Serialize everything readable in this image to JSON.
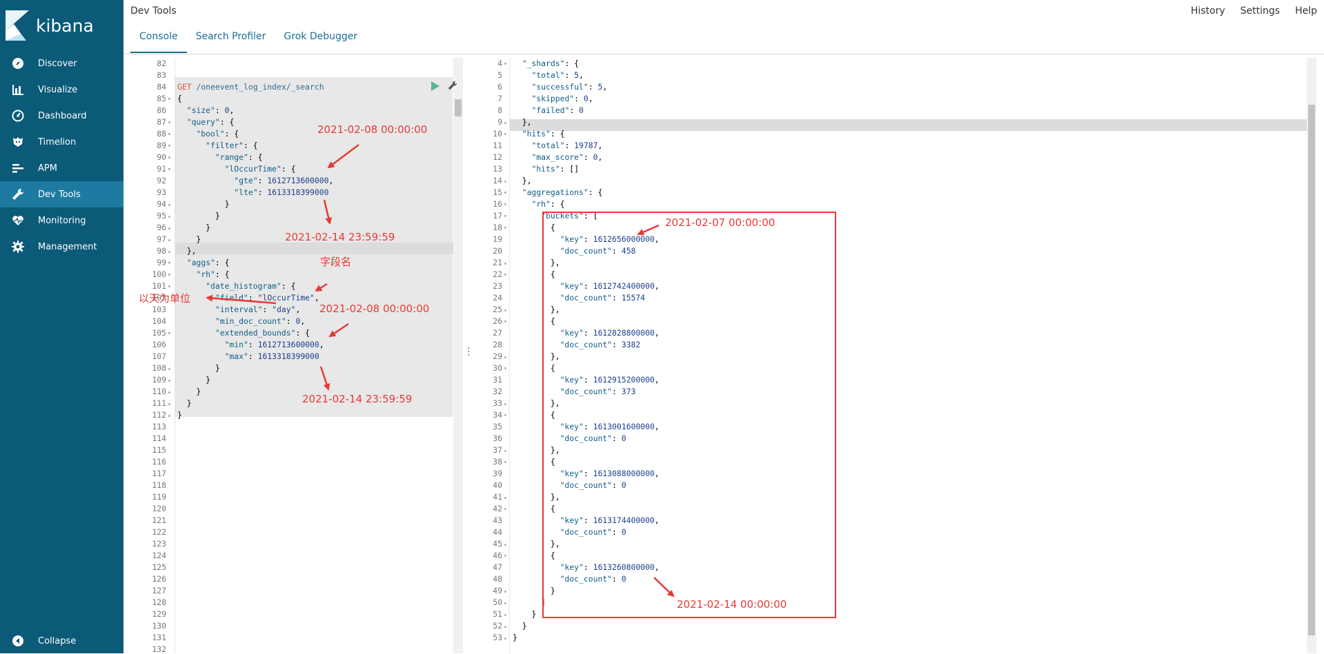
{
  "app": {
    "brand": "kibana",
    "title": "Dev Tools"
  },
  "top_links": [
    "History",
    "Settings",
    "Help"
  ],
  "tabs": [
    "Console",
    "Search Profiler",
    "Grok Debugger"
  ],
  "sidebar": {
    "items": [
      {
        "label": "Discover",
        "icon": "compass-icon"
      },
      {
        "label": "Visualize",
        "icon": "bar-chart-icon"
      },
      {
        "label": "Dashboard",
        "icon": "dashboard-icon"
      },
      {
        "label": "Timelion",
        "icon": "timelion-icon"
      },
      {
        "label": "APM",
        "icon": "apm-icon"
      },
      {
        "label": "Dev Tools",
        "icon": "wrench-icon",
        "active": true
      },
      {
        "label": "Monitoring",
        "icon": "heartbeat-icon"
      },
      {
        "label": "Management",
        "icon": "gear-icon"
      }
    ],
    "collapse_label": "Collapse"
  },
  "left_editor": {
    "lines": [
      {
        "n": "82",
        "f": "",
        "t": ""
      },
      {
        "n": "83",
        "f": "",
        "t": ""
      },
      {
        "n": "84",
        "f": "",
        "t": "GET /oneevent_log_index/_search"
      },
      {
        "n": "85",
        "f": "▾",
        "t": "{"
      },
      {
        "n": "86",
        "f": "",
        "t": "  \"size\": 0,"
      },
      {
        "n": "87",
        "f": "▾",
        "t": "  \"query\": {"
      },
      {
        "n": "88",
        "f": "▾",
        "t": "    \"bool\": {"
      },
      {
        "n": "89",
        "f": "▾",
        "t": "      \"filter\": {"
      },
      {
        "n": "90",
        "f": "▾",
        "t": "        \"range\": {"
      },
      {
        "n": "91",
        "f": "▾",
        "t": "          \"lOccurTime\": {"
      },
      {
        "n": "92",
        "f": "",
        "t": "            \"gte\": 1612713600000,"
      },
      {
        "n": "93",
        "f": "",
        "t": "            \"lte\": 1613318399000"
      },
      {
        "n": "94",
        "f": "▴",
        "t": "          }"
      },
      {
        "n": "95",
        "f": "▴",
        "t": "        }"
      },
      {
        "n": "96",
        "f": "▴",
        "t": "      }"
      },
      {
        "n": "97",
        "f": "▴",
        "t": "    }"
      },
      {
        "n": "98",
        "f": "▴",
        "t": "  },"
      },
      {
        "n": "99",
        "f": "▾",
        "t": "  \"aggs\": {"
      },
      {
        "n": "100",
        "f": "▾",
        "t": "    \"rh\": {"
      },
      {
        "n": "101",
        "f": "▾",
        "t": "      \"date_histogram\": {"
      },
      {
        "n": "102",
        "f": "",
        "t": "        \"field\": \"lOccurTime\","
      },
      {
        "n": "103",
        "f": "",
        "t": "        \"interval\": \"day\","
      },
      {
        "n": "104",
        "f": "",
        "t": "        \"min_doc_count\": 0,"
      },
      {
        "n": "105",
        "f": "▾",
        "t": "        \"extended_bounds\": {"
      },
      {
        "n": "106",
        "f": "",
        "t": "          \"min\": 1612713600000,"
      },
      {
        "n": "107",
        "f": "",
        "t": "          \"max\": 1613318399000"
      },
      {
        "n": "108",
        "f": "▴",
        "t": "        }"
      },
      {
        "n": "109",
        "f": "▴",
        "t": "      }"
      },
      {
        "n": "110",
        "f": "▴",
        "t": "    }"
      },
      {
        "n": "111",
        "f": "▴",
        "t": "  }"
      },
      {
        "n": "112",
        "f": "▴",
        "t": "}"
      },
      {
        "n": "113",
        "f": "",
        "t": ""
      },
      {
        "n": "114",
        "f": "",
        "t": ""
      },
      {
        "n": "115",
        "f": "",
        "t": ""
      },
      {
        "n": "116",
        "f": "",
        "t": ""
      },
      {
        "n": "117",
        "f": "",
        "t": ""
      },
      {
        "n": "118",
        "f": "",
        "t": ""
      },
      {
        "n": "119",
        "f": "",
        "t": ""
      },
      {
        "n": "120",
        "f": "",
        "t": ""
      },
      {
        "n": "121",
        "f": "",
        "t": ""
      },
      {
        "n": "122",
        "f": "",
        "t": ""
      },
      {
        "n": "123",
        "f": "",
        "t": ""
      },
      {
        "n": "124",
        "f": "",
        "t": ""
      },
      {
        "n": "125",
        "f": "",
        "t": ""
      },
      {
        "n": "126",
        "f": "",
        "t": ""
      },
      {
        "n": "127",
        "f": "",
        "t": ""
      },
      {
        "n": "128",
        "f": "",
        "t": ""
      },
      {
        "n": "129",
        "f": "",
        "t": ""
      },
      {
        "n": "130",
        "f": "",
        "t": ""
      },
      {
        "n": "131",
        "f": "",
        "t": ""
      },
      {
        "n": "132",
        "f": "",
        "t": ""
      }
    ]
  },
  "right_editor": {
    "lines": [
      {
        "n": "4",
        "f": "▾",
        "t": "  \"_shards\": {"
      },
      {
        "n": "5",
        "f": "",
        "t": "    \"total\": 5,"
      },
      {
        "n": "6",
        "f": "",
        "t": "    \"successful\": 5,"
      },
      {
        "n": "7",
        "f": "",
        "t": "    \"skipped\": 0,"
      },
      {
        "n": "8",
        "f": "",
        "t": "    \"failed\": 0"
      },
      {
        "n": "9",
        "f": "▴",
        "t": "  },"
      },
      {
        "n": "10",
        "f": "▾",
        "t": "  \"hits\": {"
      },
      {
        "n": "11",
        "f": "",
        "t": "    \"total\": 19787,"
      },
      {
        "n": "12",
        "f": "",
        "t": "    \"max_score\": 0,"
      },
      {
        "n": "13",
        "f": "",
        "t": "    \"hits\": []"
      },
      {
        "n": "14",
        "f": "▴",
        "t": "  },"
      },
      {
        "n": "15",
        "f": "▾",
        "t": "  \"aggregations\": {"
      },
      {
        "n": "16",
        "f": "▾",
        "t": "    \"rh\": {"
      },
      {
        "n": "17",
        "f": "▾",
        "t": "      \"buckets\": ["
      },
      {
        "n": "18",
        "f": "▾",
        "t": "        {"
      },
      {
        "n": "19",
        "f": "",
        "t": "          \"key\": 1612656000000,"
      },
      {
        "n": "20",
        "f": "",
        "t": "          \"doc_count\": 458"
      },
      {
        "n": "21",
        "f": "▴",
        "t": "        },"
      },
      {
        "n": "22",
        "f": "▾",
        "t": "        {"
      },
      {
        "n": "23",
        "f": "",
        "t": "          \"key\": 1612742400000,"
      },
      {
        "n": "24",
        "f": "",
        "t": "          \"doc_count\": 15574"
      },
      {
        "n": "25",
        "f": "▴",
        "t": "        },"
      },
      {
        "n": "26",
        "f": "▾",
        "t": "        {"
      },
      {
        "n": "27",
        "f": "",
        "t": "          \"key\": 1612828800000,"
      },
      {
        "n": "28",
        "f": "",
        "t": "          \"doc_count\": 3382"
      },
      {
        "n": "29",
        "f": "▴",
        "t": "        },"
      },
      {
        "n": "30",
        "f": "▾",
        "t": "        {"
      },
      {
        "n": "31",
        "f": "",
        "t": "          \"key\": 1612915200000,"
      },
      {
        "n": "32",
        "f": "",
        "t": "          \"doc_count\": 373"
      },
      {
        "n": "33",
        "f": "▴",
        "t": "        },"
      },
      {
        "n": "34",
        "f": "▾",
        "t": "        {"
      },
      {
        "n": "35",
        "f": "",
        "t": "          \"key\": 1613001600000,"
      },
      {
        "n": "36",
        "f": "",
        "t": "          \"doc_count\": 0"
      },
      {
        "n": "37",
        "f": "▴",
        "t": "        },"
      },
      {
        "n": "38",
        "f": "▾",
        "t": "        {"
      },
      {
        "n": "39",
        "f": "",
        "t": "          \"key\": 1613088000000,"
      },
      {
        "n": "40",
        "f": "",
        "t": "          \"doc_count\": 0"
      },
      {
        "n": "41",
        "f": "▴",
        "t": "        },"
      },
      {
        "n": "42",
        "f": "▾",
        "t": "        {"
      },
      {
        "n": "43",
        "f": "",
        "t": "          \"key\": 1613174400000,"
      },
      {
        "n": "44",
        "f": "",
        "t": "          \"doc_count\": 0"
      },
      {
        "n": "45",
        "f": "▴",
        "t": "        },"
      },
      {
        "n": "46",
        "f": "▾",
        "t": "        {"
      },
      {
        "n": "47",
        "f": "",
        "t": "          \"key\": 1613260800000,"
      },
      {
        "n": "48",
        "f": "",
        "t": "          \"doc_count\": 0"
      },
      {
        "n": "49",
        "f": "▴",
        "t": "        }"
      },
      {
        "n": "50",
        "f": "▴",
        "t": "      ]"
      },
      {
        "n": "51",
        "f": "▴",
        "t": "    }"
      },
      {
        "n": "52",
        "f": "▴",
        "t": "  }"
      },
      {
        "n": "53",
        "f": "▴",
        "t": "}"
      }
    ]
  },
  "annotations": {
    "a1": "2021-02-08 00:00:00",
    "a2": "2021-02-14 23:59:59",
    "a3": "字段名",
    "a4": "以天为单位",
    "a5": "2021-02-08 00:00:00",
    "a6": "2021-02-14 23:59:59",
    "a7": "2021-02-07 00:00:00",
    "a8": "2021-02-14 00:00:00"
  },
  "colors": {
    "sidebar": "#0b5a78",
    "active": "#1d7aa0",
    "annotation": "#e53935",
    "run": "#54b399"
  }
}
